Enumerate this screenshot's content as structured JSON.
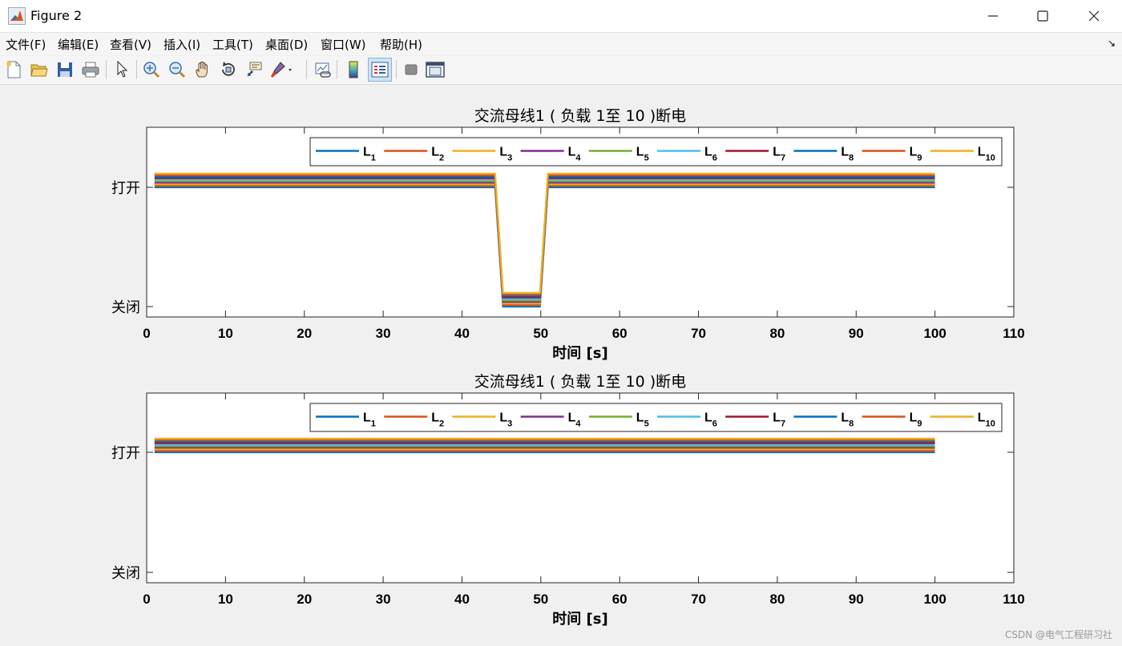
{
  "window": {
    "title": "Figure 2",
    "minimize_icon": "minimize-icon",
    "maximize_icon": "maximize-icon",
    "close_icon": "close-icon"
  },
  "menu": [
    {
      "name": "file",
      "label": "文件(F)"
    },
    {
      "name": "edit",
      "label": "编辑(E)"
    },
    {
      "name": "view",
      "label": "查看(V)"
    },
    {
      "name": "insert",
      "label": "插入(I)"
    },
    {
      "name": "tools",
      "label": "工具(T)"
    },
    {
      "name": "desktop",
      "label": "桌面(D)"
    },
    {
      "name": "window",
      "label": "窗口(W)"
    },
    {
      "name": "help",
      "label": "帮助(H)"
    }
  ],
  "toolbar": [
    "new-figure-icon",
    "open-icon",
    "save-icon",
    "print-icon",
    "edit-plot-arrow-icon",
    "zoom-in-icon",
    "zoom-out-icon",
    "pan-hand-icon",
    "rotate-3d-icon",
    "data-cursor-icon",
    "brush-icon",
    "link-plot-icon",
    "insert-colorbar-icon",
    "insert-legend-icon",
    "hide-plot-tools-icon",
    "show-plot-tools-icon"
  ],
  "watermark": "CSDN @电气工程研习社",
  "chart_data": [
    {
      "type": "line",
      "title": "交流母线1 ( 负载 1至 10 )断电",
      "xlabel": "时间 [s]",
      "ylabel": "",
      "xlim": [
        0,
        110
      ],
      "xticks": [
        0,
        10,
        20,
        30,
        40,
        50,
        60,
        70,
        80,
        90,
        100,
        110
      ],
      "yticks": [
        {
          "value": 0,
          "label": "关闭"
        },
        {
          "value": 1,
          "label": "打开"
        }
      ],
      "legend_position": "top-right",
      "series": [
        {
          "name": "L",
          "sub": "1",
          "color": "#0072BD",
          "offset": 0.0,
          "x": [
            1,
            44.2,
            45.2,
            49.9,
            50.9,
            100
          ],
          "y": [
            1,
            1,
            0,
            0,
            1,
            1
          ]
        },
        {
          "name": "L",
          "sub": "2",
          "color": "#D95319",
          "offset": 0.01,
          "x": [
            1,
            44.2,
            45.2,
            49.9,
            50.9,
            100
          ],
          "y": [
            1,
            1,
            0,
            0,
            1,
            1
          ]
        },
        {
          "name": "L",
          "sub": "3",
          "color": "#EDB120",
          "offset": 0.02,
          "x": [
            1,
            44.2,
            45.2,
            49.9,
            50.9,
            100
          ],
          "y": [
            1,
            1,
            0,
            0,
            1,
            1
          ]
        },
        {
          "name": "L",
          "sub": "4",
          "color": "#7E2F8E",
          "offset": 0.03,
          "x": [
            1,
            44.2,
            45.2,
            49.9,
            50.9,
            100
          ],
          "y": [
            1,
            1,
            0,
            0,
            1,
            1
          ]
        },
        {
          "name": "L",
          "sub": "5",
          "color": "#77AC30",
          "offset": 0.04,
          "x": [
            1,
            44.2,
            45.2,
            49.9,
            50.9,
            100
          ],
          "y": [
            1,
            1,
            0,
            0,
            1,
            1
          ]
        },
        {
          "name": "L",
          "sub": "6",
          "color": "#4DBEEE",
          "offset": 0.05,
          "x": [
            1,
            44.2,
            45.2,
            49.9,
            50.9,
            100
          ],
          "y": [
            1,
            1,
            0,
            0,
            1,
            1
          ]
        },
        {
          "name": "L",
          "sub": "7",
          "color": "#A2142F",
          "offset": 0.06,
          "x": [
            1,
            44.2,
            45.2,
            49.9,
            50.9,
            100
          ],
          "y": [
            1,
            1,
            0,
            0,
            1,
            1
          ]
        },
        {
          "name": "L",
          "sub": "8",
          "color": "#0072BD",
          "offset": 0.07,
          "x": [
            1,
            44.2,
            45.2,
            49.9,
            50.9,
            100
          ],
          "y": [
            1,
            1,
            0,
            0,
            1,
            1
          ]
        },
        {
          "name": "L",
          "sub": "9",
          "color": "#D95319",
          "offset": 0.08,
          "x": [
            1,
            44.2,
            45.2,
            49.9,
            50.9,
            100
          ],
          "y": [
            1,
            1,
            0,
            0,
            1,
            1
          ]
        },
        {
          "name": "L",
          "sub": "10",
          "color": "#EDB120",
          "offset": 0.09,
          "x": [
            1,
            44.2,
            45.2,
            49.9,
            50.9,
            100
          ],
          "y": [
            1,
            1,
            0,
            0,
            1,
            1
          ]
        }
      ]
    },
    {
      "type": "line",
      "title": "交流母线1 ( 负载 1至 10 )断电",
      "xlabel": "时间 [s]",
      "ylabel": "",
      "xlim": [
        0,
        110
      ],
      "xticks": [
        0,
        10,
        20,
        30,
        40,
        50,
        60,
        70,
        80,
        90,
        100,
        110
      ],
      "yticks": [
        {
          "value": 0,
          "label": "关闭"
        },
        {
          "value": 1,
          "label": "打开"
        }
      ],
      "legend_position": "top-right",
      "series": [
        {
          "name": "L",
          "sub": "1",
          "color": "#0072BD",
          "offset": 0.0,
          "x": [
            1,
            100
          ],
          "y": [
            1,
            1
          ]
        },
        {
          "name": "L",
          "sub": "2",
          "color": "#D95319",
          "offset": 0.01,
          "x": [
            1,
            100
          ],
          "y": [
            1,
            1
          ]
        },
        {
          "name": "L",
          "sub": "3",
          "color": "#EDB120",
          "offset": 0.02,
          "x": [
            1,
            100
          ],
          "y": [
            1,
            1
          ]
        },
        {
          "name": "L",
          "sub": "4",
          "color": "#7E2F8E",
          "offset": 0.03,
          "x": [
            1,
            100
          ],
          "y": [
            1,
            1
          ]
        },
        {
          "name": "L",
          "sub": "5",
          "color": "#77AC30",
          "offset": 0.04,
          "x": [
            1,
            100
          ],
          "y": [
            1,
            1
          ]
        },
        {
          "name": "L",
          "sub": "6",
          "color": "#4DBEEE",
          "offset": 0.05,
          "x": [
            1,
            100
          ],
          "y": [
            1,
            1
          ]
        },
        {
          "name": "L",
          "sub": "7",
          "color": "#A2142F",
          "offset": 0.06,
          "x": [
            1,
            100
          ],
          "y": [
            1,
            1
          ]
        },
        {
          "name": "L",
          "sub": "8",
          "color": "#0072BD",
          "offset": 0.07,
          "x": [
            1,
            100
          ],
          "y": [
            1,
            1
          ]
        },
        {
          "name": "L",
          "sub": "9",
          "color": "#D95319",
          "offset": 0.08,
          "x": [
            1,
            100
          ],
          "y": [
            1,
            1
          ]
        },
        {
          "name": "L",
          "sub": "10",
          "color": "#EDB120",
          "offset": 0.09,
          "x": [
            1,
            100
          ],
          "y": [
            1,
            1
          ]
        }
      ]
    }
  ]
}
